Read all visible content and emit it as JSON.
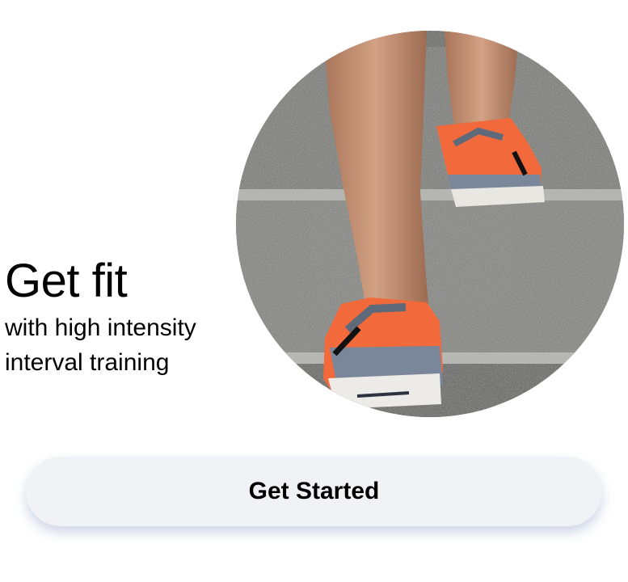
{
  "hero": {
    "image_icon": "running-shoes-on-stairs-photo"
  },
  "headline": {
    "title": "Get fit",
    "subtitle": "with high intensity interval training"
  },
  "cta": {
    "label": "Get Started"
  },
  "colors": {
    "background": "#ffffff",
    "button_background": "#f1f2f6",
    "text": "#000000",
    "shoe_orange": "#f26a3b",
    "shoe_gray": "#7a879a",
    "concrete": "#7c7c7a"
  }
}
